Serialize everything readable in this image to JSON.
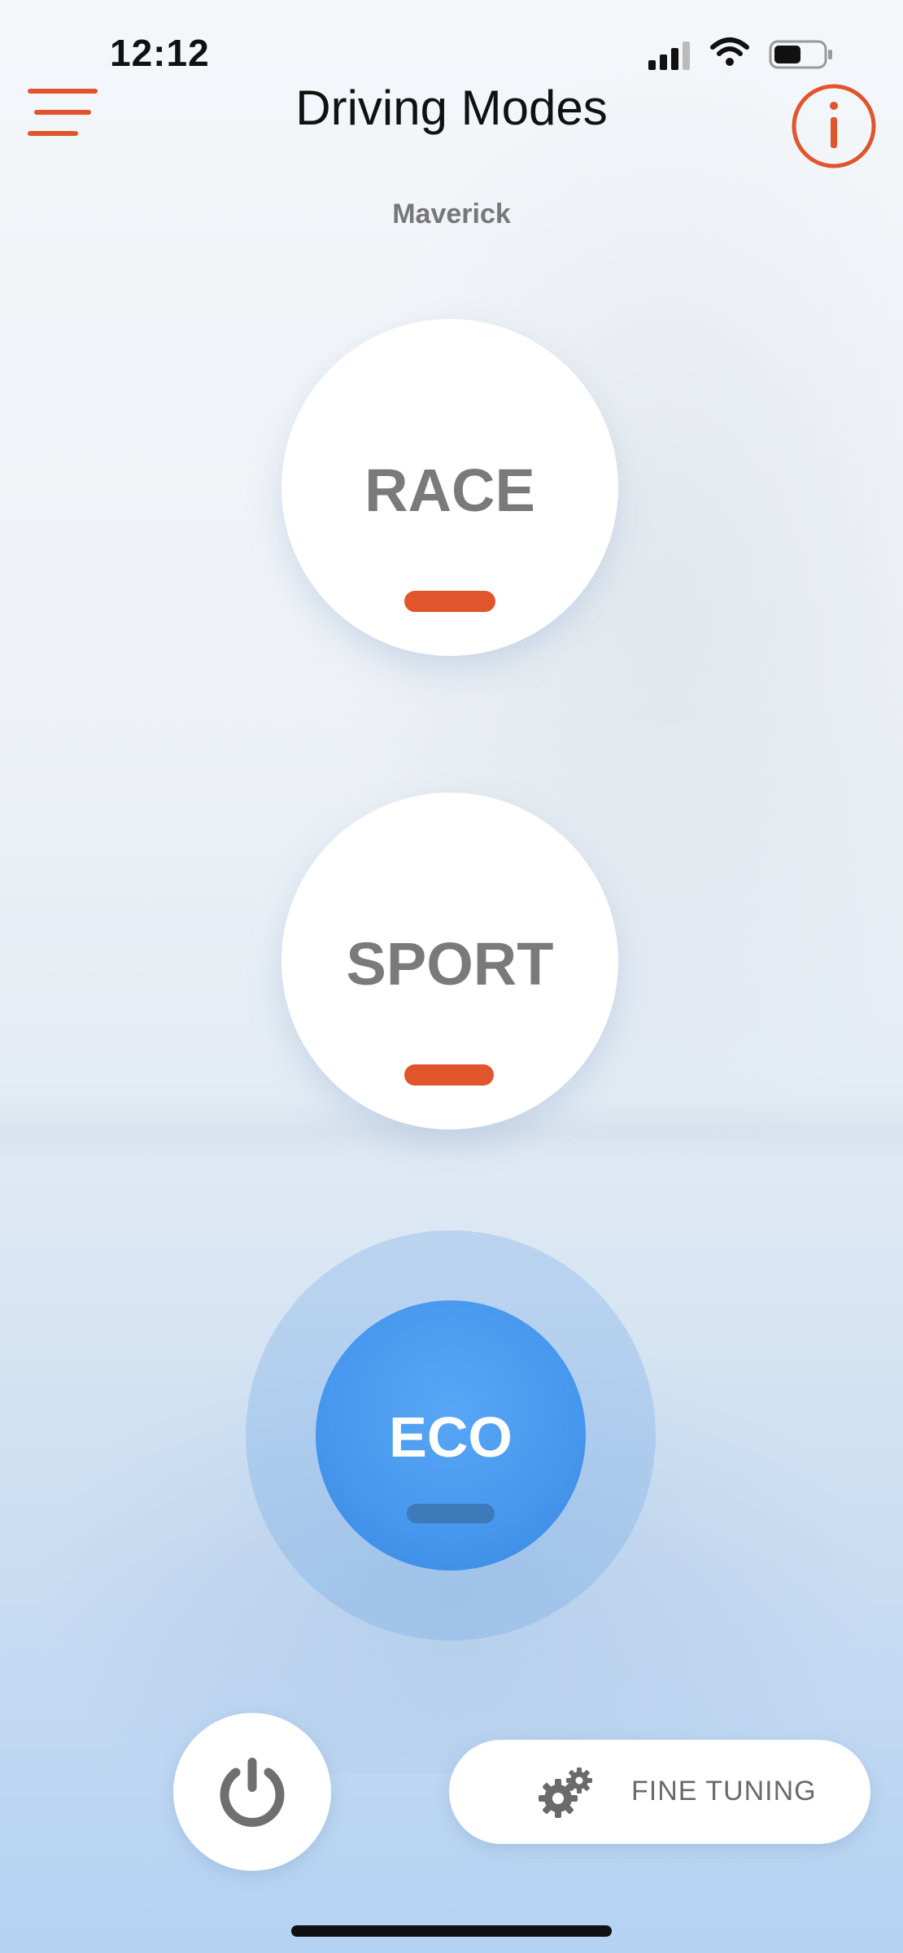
{
  "status_bar": {
    "time": "12:12",
    "battery_level": 0.55
  },
  "header": {
    "title": "Driving Modes",
    "subtitle": "Maverick"
  },
  "modes": [
    {
      "label": "RACE",
      "selected": false
    },
    {
      "label": "SPORT",
      "selected": false
    },
    {
      "label": "ECO",
      "selected": true
    }
  ],
  "bottom": {
    "fine_tuning_label": "FINE TUNING"
  },
  "icons": {
    "menu": "hamburger-icon",
    "info": "info-icon",
    "power": "power-icon",
    "settings": "gear-icon"
  },
  "colors": {
    "accent": "#e0552b",
    "selected_mode": "#4697ee",
    "mode_text": "#7a7a7a"
  }
}
